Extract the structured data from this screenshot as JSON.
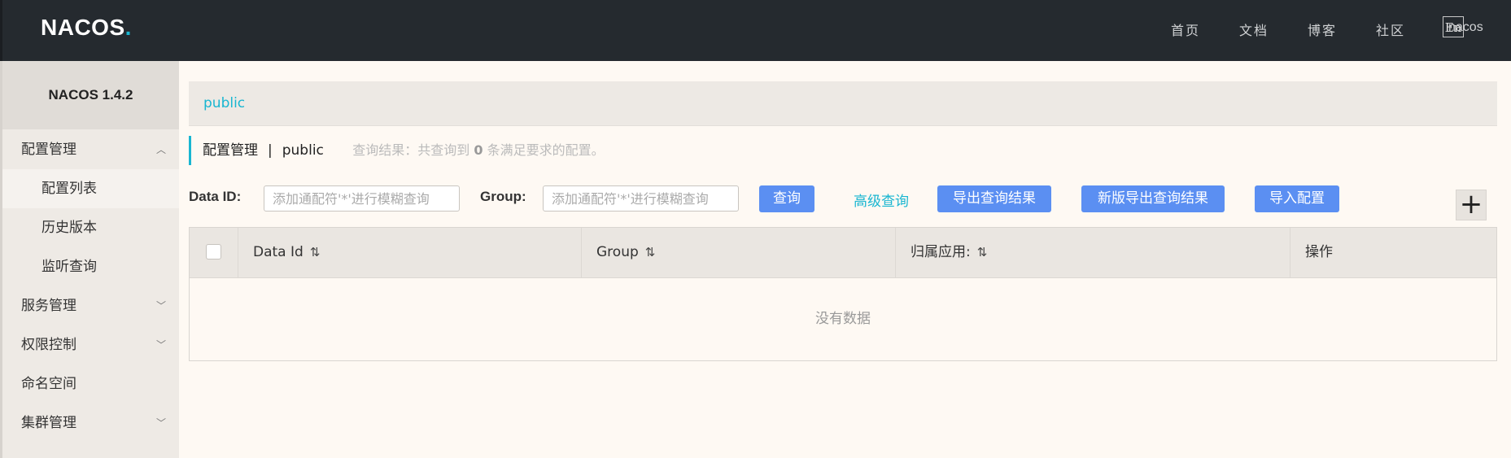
{
  "header": {
    "logo_text": "NACOS",
    "logo_dot": ".",
    "nav": [
      "首页",
      "文档",
      "博客",
      "社区"
    ],
    "lang_toggle": "En",
    "user": "nacos"
  },
  "sidebar": {
    "title": "NACOS 1.4.2",
    "items": [
      {
        "label": "配置管理",
        "expanded": true
      },
      {
        "label": "配置列表",
        "active": true
      },
      {
        "label": "历史版本"
      },
      {
        "label": "监听查询"
      },
      {
        "label": "服务管理"
      },
      {
        "label": "权限控制"
      },
      {
        "label": "命名空间"
      },
      {
        "label": "集群管理"
      }
    ]
  },
  "namespace_tab": "public",
  "page_header": {
    "title": "配置管理",
    "separator": "|",
    "namespace": "public",
    "result_prefix": "查询结果：共查询到",
    "result_count": "0",
    "result_suffix": "条满足要求的配置。"
  },
  "search": {
    "data_id_label": "Data ID:",
    "data_id_placeholder": "添加通配符'*'进行模糊查询",
    "group_label": "Group:",
    "group_placeholder": "添加通配符'*'进行模糊查询",
    "query_button": "查询",
    "advanced_link": "高级查询",
    "export_button": "导出查询结果",
    "new_export_button": "新版导出查询结果",
    "import_button": "导入配置",
    "add_button": "+"
  },
  "table": {
    "columns": [
      "Data Id",
      "Group",
      "归属应用:",
      "操作"
    ],
    "empty_text": "没有数据",
    "rows": []
  },
  "colors": {
    "header_bg": "#252a2f",
    "accent": "#19b6d1",
    "primary_button": "#5b8ff2",
    "page_bg": "#fef9f3"
  }
}
